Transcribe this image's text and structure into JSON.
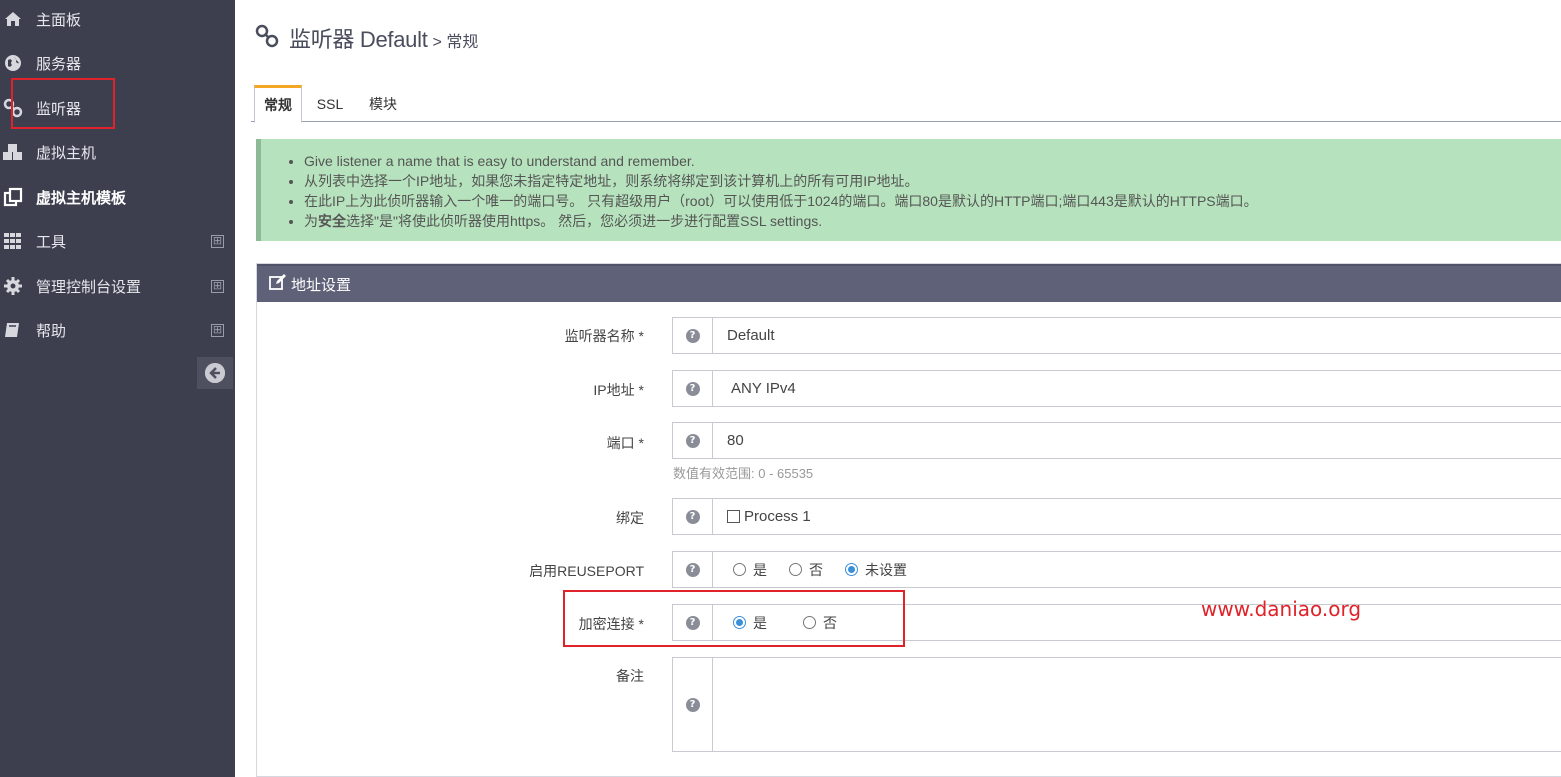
{
  "sidebar": {
    "items": [
      {
        "label": "主面板",
        "icon": "home-icon"
      },
      {
        "label": "服务器",
        "icon": "globe-icon"
      },
      {
        "label": "监听器",
        "icon": "link-icon"
      },
      {
        "label": "虚拟主机",
        "icon": "cubes-icon"
      },
      {
        "label": "虚拟主机模板",
        "icon": "copy-icon"
      },
      {
        "label": "工具",
        "icon": "grid-icon",
        "expand": "⊞"
      },
      {
        "label": "管理控制台设置",
        "icon": "gear-icon",
        "expand": "⊞"
      },
      {
        "label": "帮助",
        "icon": "book-icon",
        "expand": "⊞"
      }
    ],
    "collapse_icon": "arrow-left-circle-icon"
  },
  "header": {
    "title": "监听器 Default",
    "crumb": "> 常规"
  },
  "tabs": [
    "常规",
    "SSL",
    "模块"
  ],
  "info": [
    "Give listener a name that is easy to understand and remember.",
    "从列表中选择一个IP地址，如果您未指定特定地址，则系统将绑定到该计算机上的所有可用IP地址。",
    "在此IP上为此侦听器输入一个唯一的端口号。 只有超级用户（root）可以使用低于1024的端口。端口80是默认的HTTP端口;端口443是默认的HTTPS端口。",
    {
      "pre": "为",
      "bold": "安全",
      "post": "选择\"是\"将使此侦听器使用https。 然后，您必须进一步进行配置SSL settings."
    }
  ],
  "panel": {
    "title": "地址设置",
    "fields": {
      "name": {
        "label": "监听器名称 *",
        "value": "Default"
      },
      "ip": {
        "label": "IP地址 *",
        "value": "ANY IPv4"
      },
      "port": {
        "label": "端口 *",
        "value": "80",
        "hint": "数值有效范围: 0 - 65535"
      },
      "bind": {
        "label": "绑定",
        "option": "Process 1"
      },
      "reuseport": {
        "label": "启用REUSEPORT",
        "options": [
          "是",
          "否",
          "未设置"
        ],
        "selected": "未设置"
      },
      "secure": {
        "label": "加密连接 *",
        "options": [
          "是",
          "否"
        ],
        "selected": "是"
      },
      "notes": {
        "label": "备注",
        "value": ""
      }
    }
  },
  "watermark": "www.daniao.org",
  "colors": {
    "sidebar": "#3d3f4f",
    "panel_head": "#5e6178",
    "info_bg": "#b6e3bd",
    "accent": "#f5a623",
    "highlight": "#e0222a"
  }
}
